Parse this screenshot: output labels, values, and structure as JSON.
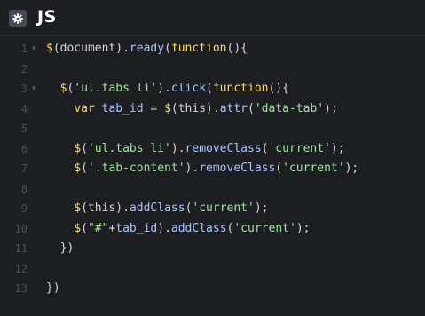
{
  "header": {
    "title": "JS",
    "settings_icon": "gear-icon"
  },
  "editor": {
    "lines": [
      {
        "n": "1",
        "fold": true,
        "tokens": [
          {
            "t": "$",
            "c": "t-fn"
          },
          {
            "t": "(document).",
            "c": "t-plain"
          },
          {
            "t": "ready",
            "c": "t-id"
          },
          {
            "t": "(",
            "c": "t-plain"
          },
          {
            "t": "function",
            "c": "t-kw"
          },
          {
            "t": "(){",
            "c": "t-plain"
          }
        ]
      },
      {
        "n": "2",
        "fold": false,
        "tokens": []
      },
      {
        "n": "3",
        "fold": true,
        "tokens": [
          {
            "t": "  ",
            "c": "t-plain"
          },
          {
            "t": "$",
            "c": "t-fn"
          },
          {
            "t": "(",
            "c": "t-plain"
          },
          {
            "t": "'ul.tabs li'",
            "c": "t-str"
          },
          {
            "t": ").",
            "c": "t-plain"
          },
          {
            "t": "click",
            "c": "t-id"
          },
          {
            "t": "(",
            "c": "t-plain"
          },
          {
            "t": "function",
            "c": "t-kw"
          },
          {
            "t": "(){",
            "c": "t-plain"
          }
        ]
      },
      {
        "n": "4",
        "fold": false,
        "tokens": [
          {
            "t": "    ",
            "c": "t-plain"
          },
          {
            "t": "var",
            "c": "t-kw"
          },
          {
            "t": " ",
            "c": "t-plain"
          },
          {
            "t": "tab_id",
            "c": "t-id"
          },
          {
            "t": " = ",
            "c": "t-op"
          },
          {
            "t": "$",
            "c": "t-fn"
          },
          {
            "t": "(this).",
            "c": "t-plain"
          },
          {
            "t": "attr",
            "c": "t-id"
          },
          {
            "t": "(",
            "c": "t-plain"
          },
          {
            "t": "'data-tab'",
            "c": "t-str"
          },
          {
            "t": ");",
            "c": "t-plain"
          }
        ]
      },
      {
        "n": "5",
        "fold": false,
        "tokens": []
      },
      {
        "n": "6",
        "fold": false,
        "tokens": [
          {
            "t": "    ",
            "c": "t-plain"
          },
          {
            "t": "$",
            "c": "t-fn"
          },
          {
            "t": "(",
            "c": "t-plain"
          },
          {
            "t": "'ul.tabs li'",
            "c": "t-str"
          },
          {
            "t": ").",
            "c": "t-plain"
          },
          {
            "t": "removeClass",
            "c": "t-id"
          },
          {
            "t": "(",
            "c": "t-plain"
          },
          {
            "t": "'current'",
            "c": "t-str"
          },
          {
            "t": ");",
            "c": "t-plain"
          }
        ]
      },
      {
        "n": "7",
        "fold": false,
        "tokens": [
          {
            "t": "    ",
            "c": "t-plain"
          },
          {
            "t": "$",
            "c": "t-fn"
          },
          {
            "t": "(",
            "c": "t-plain"
          },
          {
            "t": "'.tab-content'",
            "c": "t-str"
          },
          {
            "t": ").",
            "c": "t-plain"
          },
          {
            "t": "removeClass",
            "c": "t-id"
          },
          {
            "t": "(",
            "c": "t-plain"
          },
          {
            "t": "'current'",
            "c": "t-str"
          },
          {
            "t": ");",
            "c": "t-plain"
          }
        ]
      },
      {
        "n": "8",
        "fold": false,
        "tokens": []
      },
      {
        "n": "9",
        "fold": false,
        "tokens": [
          {
            "t": "    ",
            "c": "t-plain"
          },
          {
            "t": "$",
            "c": "t-fn"
          },
          {
            "t": "(this).",
            "c": "t-plain"
          },
          {
            "t": "addClass",
            "c": "t-id"
          },
          {
            "t": "(",
            "c": "t-plain"
          },
          {
            "t": "'current'",
            "c": "t-str"
          },
          {
            "t": ");",
            "c": "t-plain"
          }
        ]
      },
      {
        "n": "10",
        "fold": false,
        "tokens": [
          {
            "t": "    ",
            "c": "t-plain"
          },
          {
            "t": "$",
            "c": "t-fn"
          },
          {
            "t": "(",
            "c": "t-plain"
          },
          {
            "t": "\"#\"",
            "c": "t-str"
          },
          {
            "t": "+",
            "c": "t-op"
          },
          {
            "t": "tab_id",
            "c": "t-id"
          },
          {
            "t": ").",
            "c": "t-plain"
          },
          {
            "t": "addClass",
            "c": "t-id"
          },
          {
            "t": "(",
            "c": "t-plain"
          },
          {
            "t": "'current'",
            "c": "t-str"
          },
          {
            "t": ");",
            "c": "t-plain"
          }
        ]
      },
      {
        "n": "11",
        "fold": false,
        "tokens": [
          {
            "t": "  })",
            "c": "t-plain"
          }
        ]
      },
      {
        "n": "12",
        "fold": false,
        "tokens": []
      },
      {
        "n": "13",
        "fold": false,
        "tokens": [
          {
            "t": "})",
            "c": "t-plain"
          }
        ]
      }
    ]
  }
}
